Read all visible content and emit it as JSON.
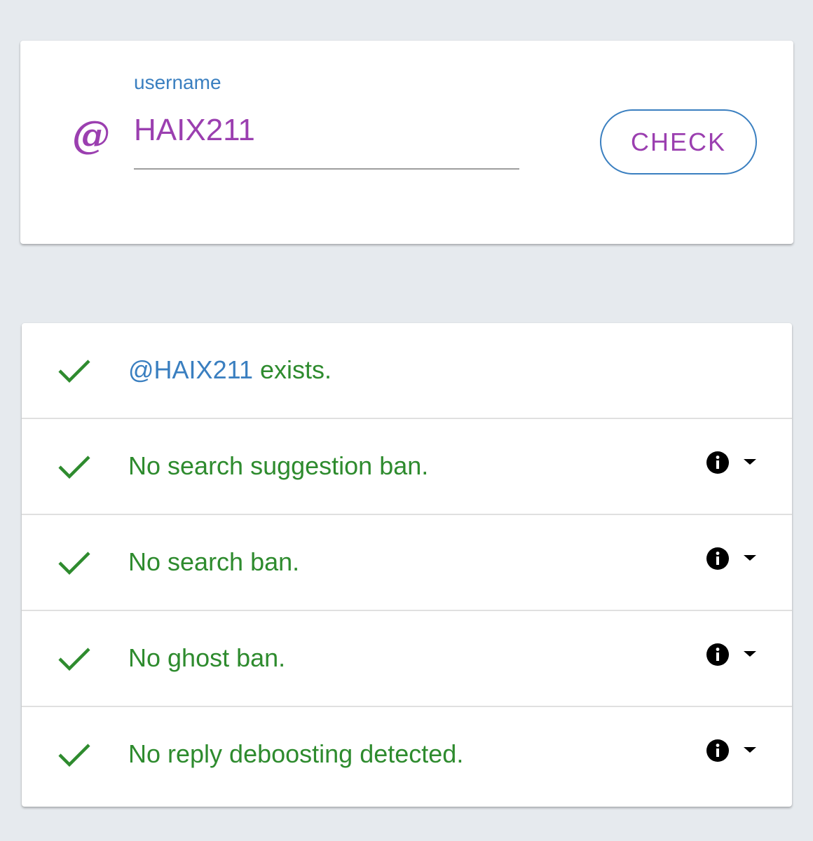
{
  "form": {
    "label": "username",
    "at_symbol": "@",
    "username_value": "HAIX211",
    "check_label": "CHECK"
  },
  "results": [
    {
      "handle": "@HAIX211",
      "text": " exists.",
      "has_info": false
    },
    {
      "text": "No search suggestion ban.",
      "has_info": true
    },
    {
      "text": "No search ban.",
      "has_info": true
    },
    {
      "text": "No ghost ban.",
      "has_info": true
    },
    {
      "text": "No reply deboosting detected.",
      "has_info": true
    }
  ],
  "colors": {
    "background": "#e6eaee",
    "accent_purple": "#9b3fb0",
    "accent_blue": "#3a7fc0",
    "success_green": "#2e8b2e"
  },
  "icons": {
    "at": "at-icon",
    "check": "checkmark-icon",
    "info": "info-icon",
    "expand": "caret-down-icon"
  }
}
